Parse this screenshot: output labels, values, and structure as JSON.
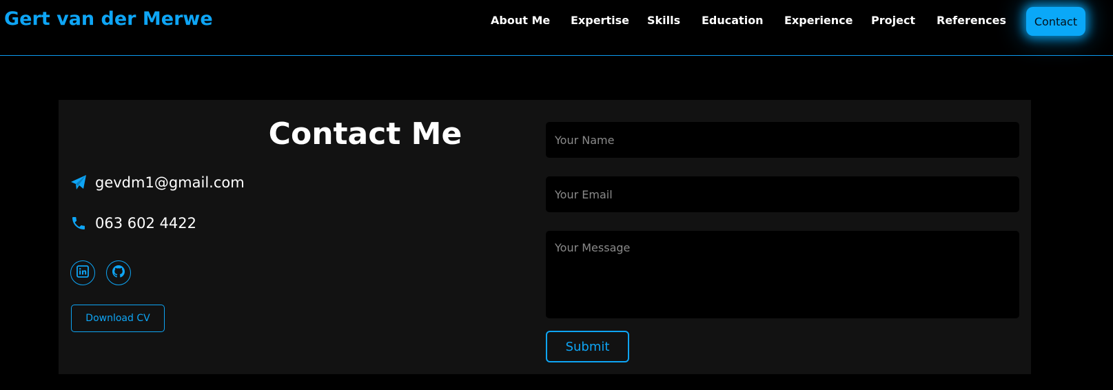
{
  "header": {
    "brand": "Gert van der Merwe",
    "nav": [
      {
        "label": "About Me"
      },
      {
        "label": "Expertise"
      },
      {
        "label": "Skills"
      },
      {
        "label": "Education"
      },
      {
        "label": "Experience"
      },
      {
        "label": "Project"
      },
      {
        "label": "References"
      },
      {
        "label": "Contact",
        "active": true
      }
    ]
  },
  "contact": {
    "title": "Contact Me",
    "email": "gevdm1@gmail.com",
    "email_icon": "paper-plane-icon",
    "phone": "063 602 4422",
    "phone_icon": "phone-icon",
    "socials": [
      {
        "icon": "linkedin-icon"
      },
      {
        "icon": "github-icon"
      }
    ],
    "cv_label": "Download CV"
  },
  "form": {
    "name_placeholder": "Your Name",
    "email_placeholder": "Your Email",
    "message_placeholder": "Your Message",
    "submit_label": "Submit"
  },
  "colors": {
    "accent": "#0ea5f5",
    "background": "#000000",
    "card": "#121212"
  }
}
